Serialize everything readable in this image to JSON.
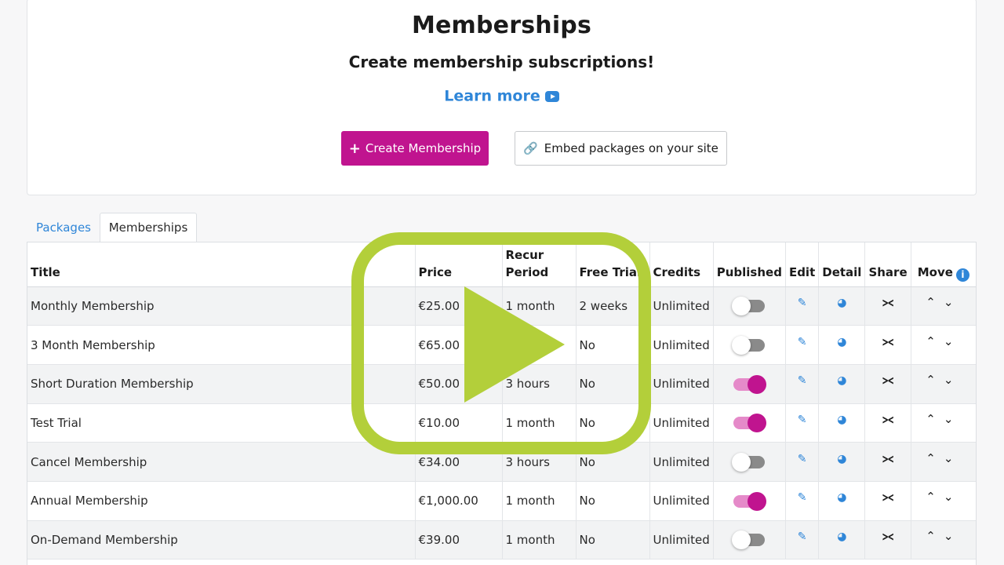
{
  "header": {
    "title": "Memberships",
    "subtitle": "Create membership subscriptions!",
    "learn_more": "Learn more",
    "create_button": "Create Membership",
    "embed_button": "Embed packages on your site"
  },
  "tabs": [
    {
      "label": "Packages",
      "active": false
    },
    {
      "label": "Memberships",
      "active": true
    }
  ],
  "table": {
    "headers": {
      "title": "Title",
      "price": "Price",
      "recur_line1": "Recur",
      "recur_line2": "Period",
      "free_trial": "Free Trial",
      "credits": "Credits",
      "published": "Published",
      "edit": "Edit",
      "detail": "Detail",
      "share": "Share",
      "move": "Move"
    },
    "rows": [
      {
        "title": "Monthly Membership",
        "price": "€25.00",
        "recur": "1 month",
        "trial": "2 weeks",
        "credits": "Unlimited",
        "published": false
      },
      {
        "title": "3 Month Membership",
        "price": "€65.00",
        "recur": "",
        "trial": "No",
        "credits": "Unlimited",
        "published": false
      },
      {
        "title": "Short Duration Membership",
        "price": "€50.00",
        "recur": "3 hours",
        "trial": "No",
        "credits": "Unlimited",
        "published": true
      },
      {
        "title": "Test Trial",
        "price": "€10.00",
        "recur": "1 month",
        "trial": "No",
        "credits": "Unlimited",
        "published": true
      },
      {
        "title": "Cancel Membership",
        "price": "€34.00",
        "recur": "3 hours",
        "trial": "No",
        "credits": "Unlimited",
        "published": false
      },
      {
        "title": "Annual Membership",
        "price": "€1,000.00",
        "recur": "1 month",
        "trial": "No",
        "credits": "Unlimited",
        "published": true
      },
      {
        "title": "On-Demand Membership",
        "price": "€39.00",
        "recur": "1 month",
        "trial": "No",
        "credits": "Unlimited",
        "published": false
      }
    ]
  },
  "icons": {
    "edit": "edit-icon",
    "detail": "gauge-icon",
    "share": "share-icon",
    "move_up": "chevron-up-icon",
    "move_down": "chevron-down-icon",
    "info": "info-icon",
    "video": "youtube-icon",
    "link": "link-icon",
    "play": "play-icon"
  },
  "colors": {
    "brand": "#c0148f",
    "link": "#2f86d8",
    "play_overlay": "#b3cf3a",
    "toggle_off": "#8a8a8a",
    "toggle_on_track": "#e58ac9"
  }
}
